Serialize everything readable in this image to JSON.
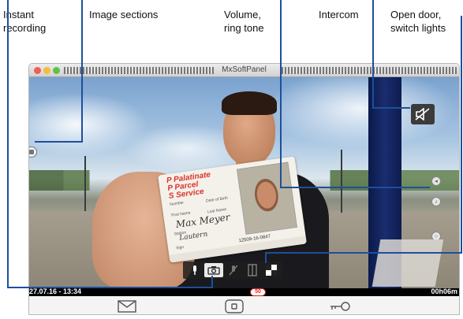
{
  "annotations": {
    "instant_recording": "Instant\nrecording",
    "image_sections": "Image sections",
    "volume_ring_tone": "Volume,\nring tone",
    "intercom": "Intercom",
    "open_door_switch_lights": "Open door,\nswitch lights"
  },
  "window": {
    "title": "MxSoftPanel"
  },
  "video": {
    "id_card": {
      "brand_line1": "P Palatinate",
      "brand_line2": "P Parcel",
      "brand_line3": "S Service",
      "number_label": "Number",
      "date_of_birth_label": "Date of Birth",
      "first_name_label": "First Name",
      "last_name_label": "Last Name",
      "name_written": "Max  Meyer",
      "station_label": "Station",
      "station_written": "Lautern",
      "sign_label": "Sign",
      "card_number": "12509-16-0847"
    }
  },
  "status": {
    "date_time": "27.07.16 - 13:34",
    "volume_badge": "50",
    "elapsed": "00h06m"
  },
  "icons": {
    "microphone": "microphone-icon",
    "camera": "camera-icon",
    "mute": "mic-off-icon",
    "split": "split-screen-icon",
    "quad": "quad-view-icon",
    "speaker_off": "speaker-off-icon",
    "mail": "mail-icon",
    "door_panel": "door-panel-icon",
    "key": "key-icon"
  },
  "colors": {
    "annotation_line": "#1d4f9c",
    "volume_badge": "#dd2222"
  }
}
